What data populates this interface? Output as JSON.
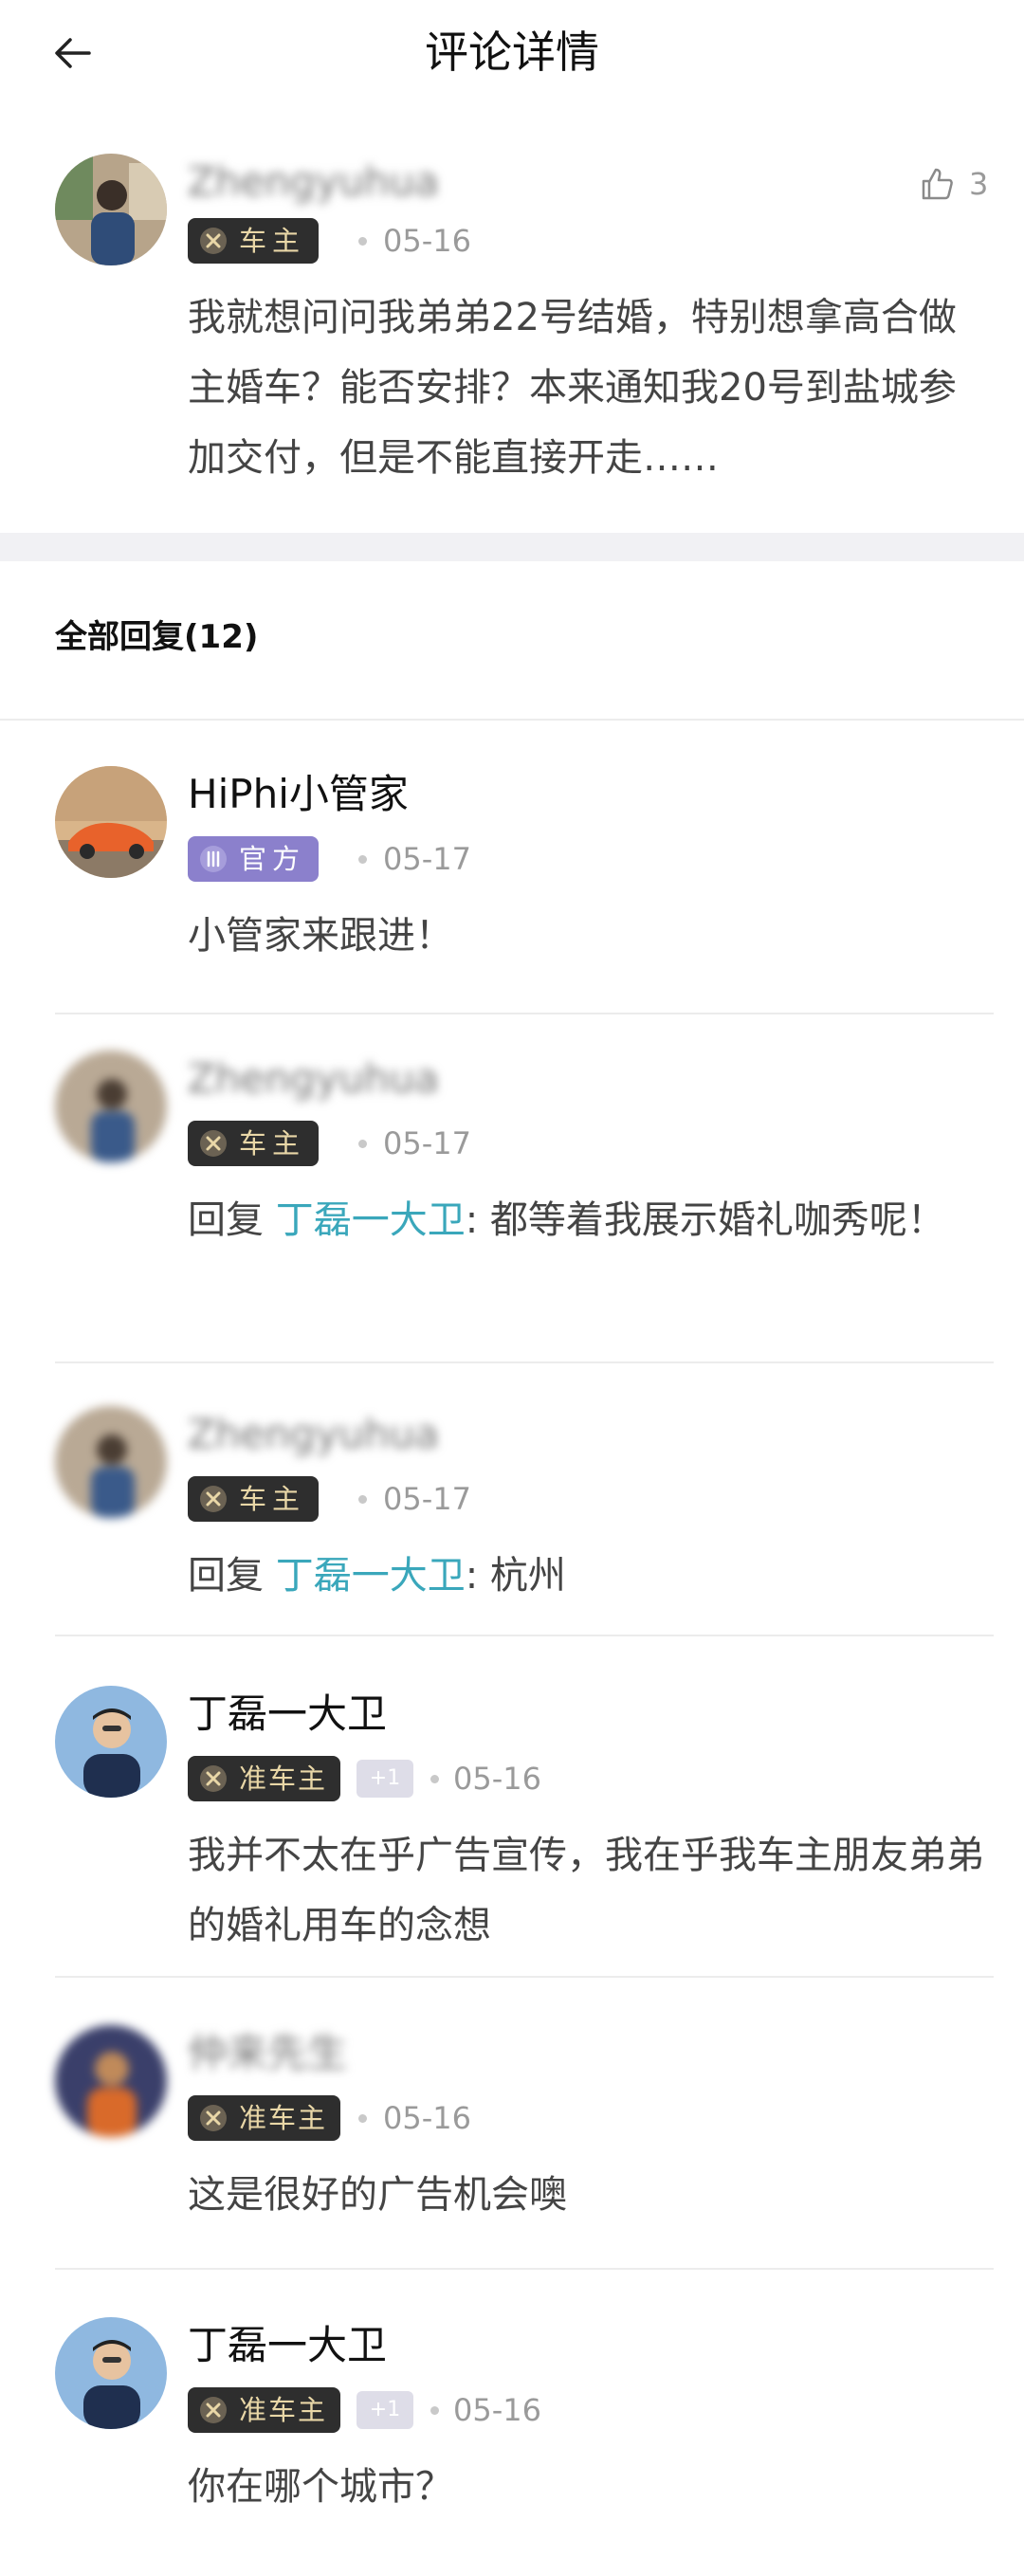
{
  "header": {
    "title": "评论详情"
  },
  "main_comment": {
    "user": "Zhengyuhua",
    "badge": "车主",
    "date": "05-16",
    "likes": "3",
    "content": "我就想问问我弟弟22号结婚，特别想拿高合做主婚车？能否安排？本来通知我20号到盐城参加交付，但是不能直接开走……"
  },
  "replies_header": "全部回复(12)",
  "replies": [
    {
      "user": "HiPhi小管家",
      "badge": "官方",
      "date": "05-17",
      "content": "小管家来跟进！"
    },
    {
      "user": "Zhengyuhua",
      "badge": "车主",
      "date": "05-17",
      "reply_prefix": "回复 ",
      "reply_to": "丁磊一大卫",
      "content": ": 都等着我展示婚礼咖秀呢！"
    },
    {
      "user": "Zhengyuhua",
      "badge": "车主",
      "date": "05-17",
      "reply_prefix": "回复 ",
      "reply_to": "丁磊一大卫",
      "content": ": 杭州"
    },
    {
      "user": "丁磊一大卫",
      "badge": "准车主",
      "plus": "+1",
      "date": "05-16",
      "content": "我并不太在乎广告宣传，我在乎我车主朋友弟弟的婚礼用车的念想"
    },
    {
      "user": "仲来先生",
      "badge": "准车主",
      "date": "05-16",
      "content": "这是很好的广告机会噢"
    },
    {
      "user": "丁磊一大卫",
      "badge": "准车主",
      "plus": "+1",
      "date": "05-16",
      "content": "你在哪个城市？"
    }
  ],
  "colors": {
    "accent_link": "#3aa7bb",
    "owner_badge_bg": "#2e2e2e",
    "owner_badge_text": "#e9d7a7",
    "official_badge_bg": "#8b80cc",
    "separator": "#f1f1f4"
  }
}
